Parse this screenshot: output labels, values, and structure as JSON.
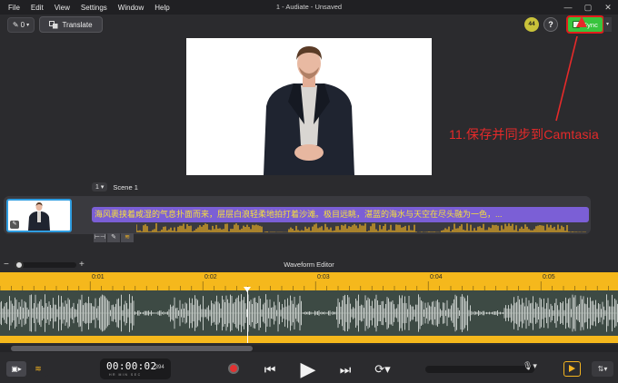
{
  "menubar": {
    "items": [
      "File",
      "Edit",
      "View",
      "Settings",
      "Window",
      "Help"
    ],
    "window_title": "1 - Audiate - Unsaved",
    "controls": [
      "—",
      "▢",
      "✕"
    ]
  },
  "toolbar": {
    "edit_value": "0",
    "translate_label": "Translate",
    "badge_count": "44",
    "help_label": "?",
    "sync_label": "Sync"
  },
  "annotation": {
    "text": "11.保存并同步到Camtasia",
    "color": "#e62a2a"
  },
  "scene": {
    "number": "1",
    "title": "Scene 1",
    "transcript": "海风裹挟着咸湿的气息扑面而来，层层白浪轻柔地拍打着沙滩。极目远眺，湛蓝的海水与天空在尽头融为一色，..."
  },
  "waveform_editor": {
    "title": "Waveform Editor",
    "zoom_minus": "−",
    "zoom_plus": "+",
    "ticks": [
      "0:01",
      "0:02",
      "0:03",
      "0:04",
      "0:05"
    ]
  },
  "transport": {
    "timecode": "00:00:02",
    "timecode_frac": ".394",
    "timecode_units": "HR MIN SEC"
  },
  "colors": {
    "accent_yellow": "#f5b81c",
    "sync_green": "#38c43d",
    "highlight_purple": "#7b5fd6"
  }
}
